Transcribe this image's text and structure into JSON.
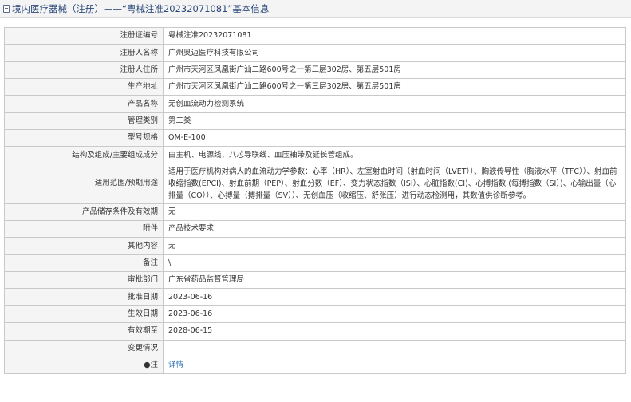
{
  "header": {
    "title": "境内医疗器械（注册）——“粤械注准20232071081”基本信息"
  },
  "rows": [
    {
      "label": "注册证编号",
      "value": "粤械注准20232071081"
    },
    {
      "label": "注册人名称",
      "value": "广州奥迈医疗科技有限公司"
    },
    {
      "label": "注册人住所",
      "value": "广州市天河区凤凰街广汕二路600号之一第三层302房、第五层501房"
    },
    {
      "label": "生产地址",
      "value": "广州市天河区凤凰街广汕二路600号之一第三层302房、第五层501房"
    },
    {
      "label": "产品名称",
      "value": "无创血流动力检测系统"
    },
    {
      "label": "管理类别",
      "value": "第二类"
    },
    {
      "label": "型号规格",
      "value": "OM-E-100"
    },
    {
      "label": "结构及组成/主要组成成分",
      "value": "由主机、电源线、八芯导联线、血压袖带及延长管组成。"
    },
    {
      "label": "适用范围/预期用途",
      "value": "适用于医疗机构对病人的血流动力学参数：心率（HR）、左室射血时间（射血时间（LVET））、胸液传导性（胸液水平（TFC））、射血前收缩指数(EPCI)、射血前期（PEP）、射血分数（EF）、变力状态指数（ISI）、心脏指数(CI)、心搏指数 (每搏指数（SI）)、心输出量（心排量（CO））、心搏量（搏排量（SV））、无创血压（收缩压、舒张压）进行动态检测用，其数值供诊断参考。"
    },
    {
      "label": "产品储存条件及有效期",
      "value": "无"
    },
    {
      "label": "附件",
      "value": "产品技术要求"
    },
    {
      "label": "其他内容",
      "value": "无"
    },
    {
      "label": "备注",
      "value": "\\"
    },
    {
      "label": "审批部门",
      "value": "广东省药品监督管理局"
    },
    {
      "label": "批准日期",
      "value": "2023-06-16"
    },
    {
      "label": "生效日期",
      "value": "2023-06-16"
    },
    {
      "label": "有效期至",
      "value": "2028-06-15"
    },
    {
      "label": "变更情况",
      "value": ""
    },
    {
      "label": "●注",
      "value": "详情"
    }
  ]
}
